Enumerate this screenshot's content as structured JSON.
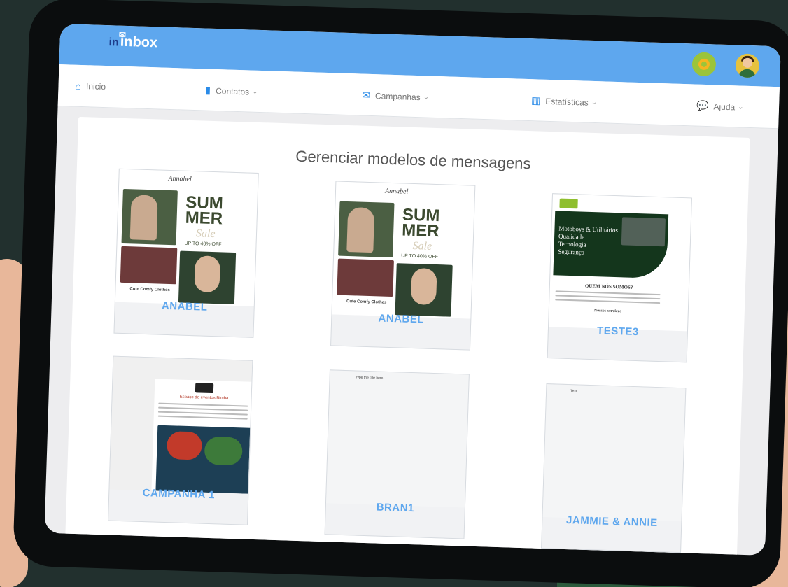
{
  "app": {
    "logo_prefix": "in",
    "logo_text": "inbox"
  },
  "nav": {
    "home": "Inicio",
    "contacts": "Contatos",
    "campaigns": "Campanhas",
    "stats": "Estatísticas",
    "help": "Ajuda"
  },
  "page": {
    "title": "Gerenciar modelos de mensagens"
  },
  "templates": [
    {
      "name": "ANABEL",
      "headline_1": "SUM",
      "headline_2": "MER",
      "headline_3": "Sale",
      "promo": "UP TO 40% OFF",
      "caption": "Cute Comfy Clothes",
      "brand": "Annabel"
    },
    {
      "name": "ANABEL",
      "headline_1": "SUM",
      "headline_2": "MER",
      "headline_3": "Sale",
      "promo": "UP TO 40% OFF",
      "caption": "Cute Comfy Clothes",
      "brand": "Annabel"
    },
    {
      "name": "TESTE3",
      "lines": [
        "Motoboys & Utilitários",
        "Qualidade",
        "Tecnologia",
        "Segurança"
      ],
      "section": "QUEM NÓS SOMOS?",
      "services": "Nossos serviços"
    },
    {
      "name": "CAMPANHA 1",
      "header": "Espaço de eventos Bimba"
    },
    {
      "name": "BRAN1",
      "text": "Type the title here"
    },
    {
      "name": "JAMMIE & ANNIE",
      "text": "Text"
    }
  ],
  "colors": {
    "topbar": "#5ea7ee",
    "accent": "#2a8be8",
    "card_label": "#5ea7ee"
  }
}
